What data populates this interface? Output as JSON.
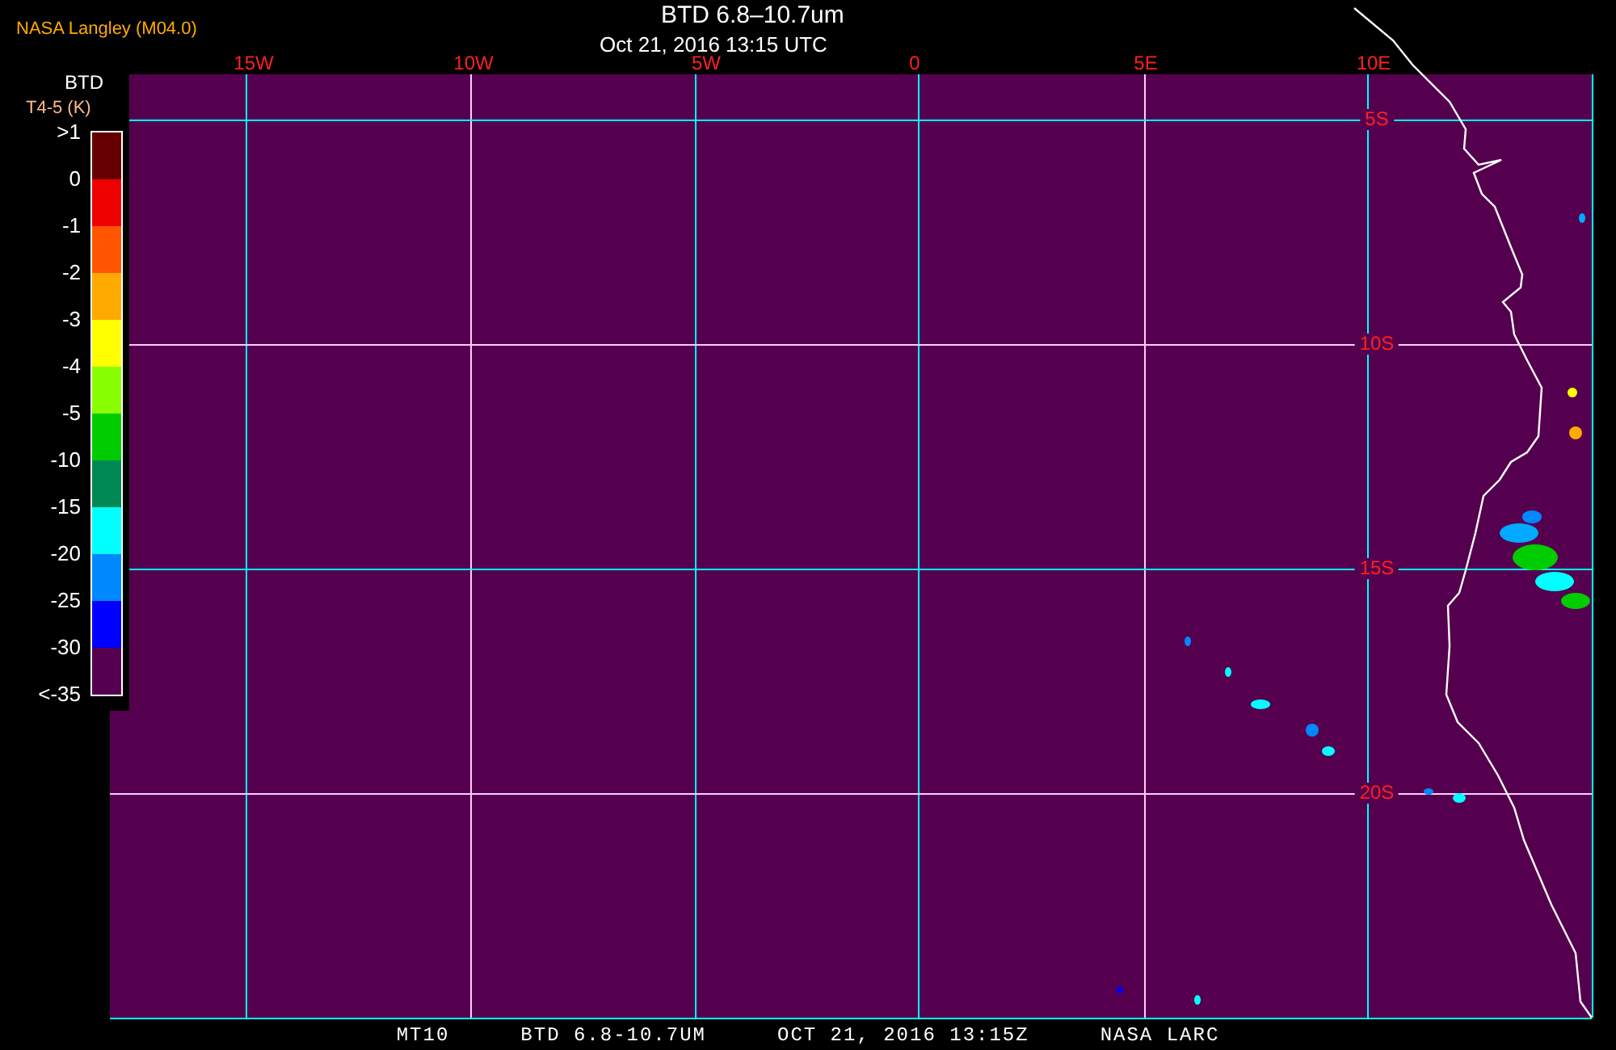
{
  "header": {
    "source": "NASA Langley (M04.0)",
    "title": "BTD 6.8–10.7um",
    "datetime": "Oct 21, 2016 13:15 UTC"
  },
  "legend": {
    "title": "BTD",
    "unit": "T4-5 (K)",
    "labels": [
      ">1",
      "0",
      "-1",
      "-2",
      "-3",
      "-4",
      "-5",
      "-10",
      "-15",
      "-20",
      "-25",
      "-30",
      "<-35"
    ],
    "bands": [
      {
        "color": "#660000"
      },
      {
        "color": "#ee0000"
      },
      {
        "color": "#ff5500"
      },
      {
        "color": "#ffaa00"
      },
      {
        "color": "#ffff00"
      },
      {
        "color": "#88ff00"
      },
      {
        "color": "#00cc00"
      },
      {
        "color": "#008855"
      },
      {
        "color": "#00ffff"
      },
      {
        "color": "#0088ff"
      },
      {
        "color": "#0000ff"
      },
      {
        "color": "#55004f"
      }
    ]
  },
  "map": {
    "lon_labels": [
      "15W",
      "10W",
      "5W",
      "0",
      "5E",
      "10E"
    ],
    "lat_labels": [
      "5S",
      "10S",
      "15S",
      "20S"
    ]
  },
  "footer": [
    "MT10",
    "BTD 6.8-10.7UM",
    "OCT 21, 2016 13:15Z",
    "NASA LARC"
  ]
}
